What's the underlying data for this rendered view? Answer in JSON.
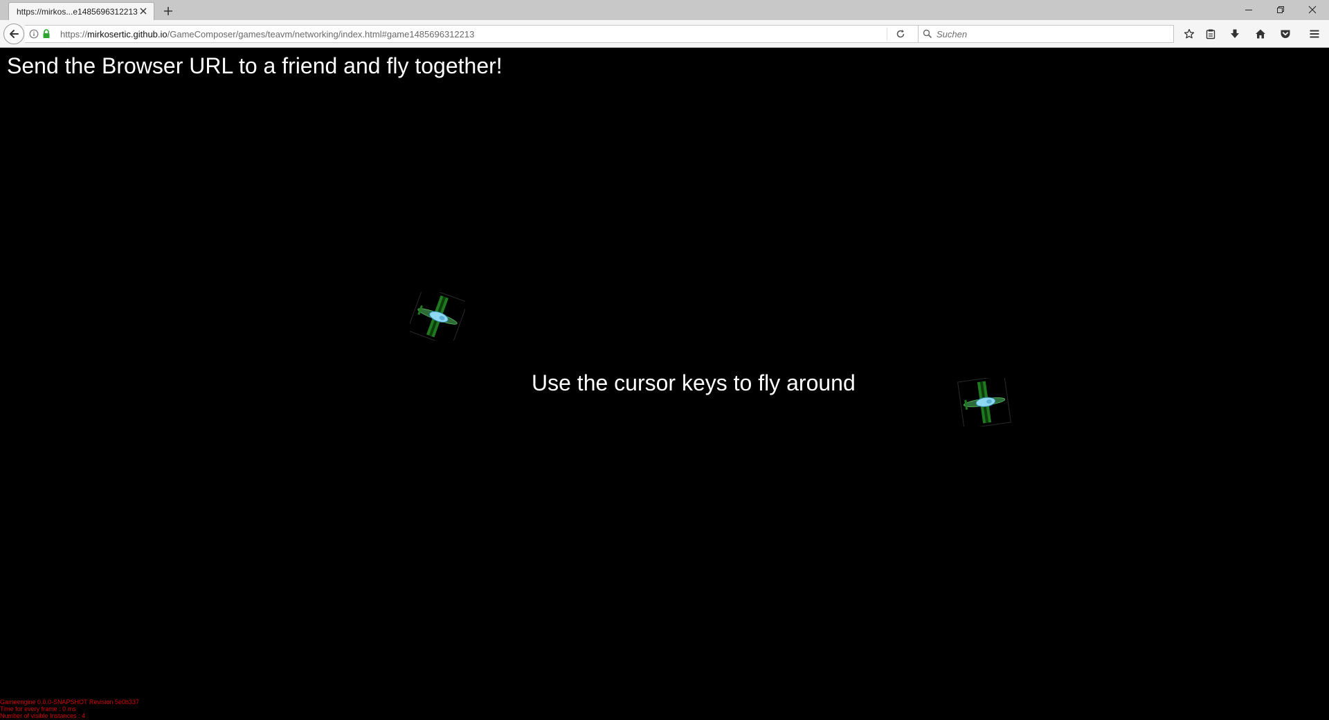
{
  "browser": {
    "tab": {
      "title": "https://mirkos...e1485696312213"
    },
    "url": {
      "scheme": "https://",
      "host": "mirkosertic.github.io",
      "path": "/GameComposer/games/teavm/networking/index.html#game1485696312213"
    },
    "search": {
      "placeholder": "Suchen"
    }
  },
  "page": {
    "headline": "Send the Browser URL to a friend and fly together!",
    "center_hint": "Use the cursor keys to fly around",
    "debug_lines": [
      "Gameengine 0.0.0-SNAPSHOT Revision 5e0b337",
      "Time for every frame : 0 ms",
      "Number of visible Instances : 4"
    ]
  },
  "colors": {
    "debug_text": "#d40000",
    "plane_wing": "#1f7a1f",
    "plane_body": "#8fd8f2"
  }
}
